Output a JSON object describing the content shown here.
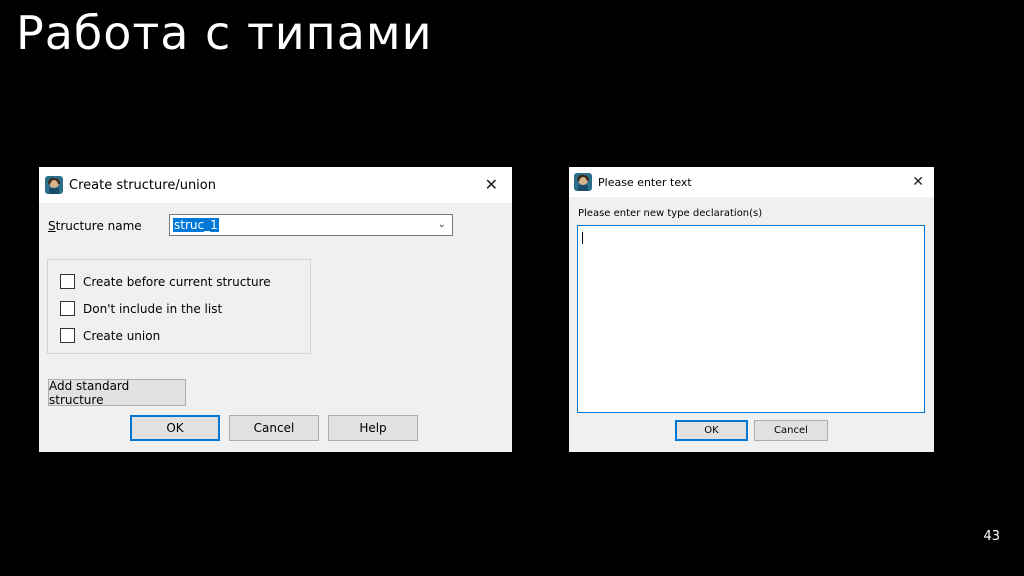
{
  "slide": {
    "title": "Работа с типами",
    "page_number": "43"
  },
  "dialog_struct": {
    "title": "Create structure/union",
    "name_label": "Structure name",
    "name_value": "struc_1",
    "options": [
      {
        "label": "Create before current structure",
        "checked": false
      },
      {
        "label": "Don't include in the list",
        "checked": false
      },
      {
        "label": "Create union",
        "checked": false
      }
    ],
    "add_standard_label": "Add standard structure",
    "ok_label": "OK",
    "cancel_label": "Cancel",
    "help_label": "Help"
  },
  "dialog_text": {
    "title": "Please enter text",
    "prompt": "Please enter new type declaration(s)",
    "text_value": "",
    "ok_label": "OK",
    "cancel_label": "Cancel"
  },
  "colors": {
    "background": "#000000",
    "dialog_body": "#f0f0f0",
    "accent": "#0078d7",
    "selection": "#0078d7"
  },
  "icons": [
    "ida-app-icon",
    "close-icon",
    "chevron-down-icon"
  ]
}
